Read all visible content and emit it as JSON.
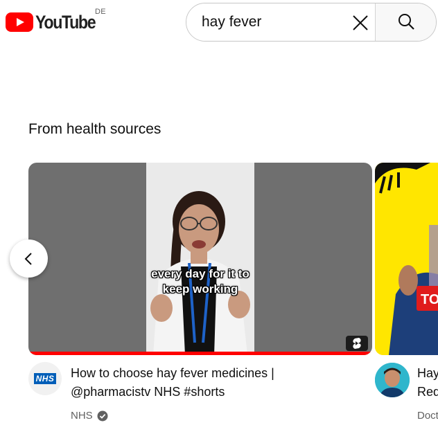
{
  "header": {
    "logo_text": "YouTube",
    "country_code": "DE",
    "search": {
      "value": "hay fever",
      "clear_icon": "close-icon",
      "search_icon": "search-icon"
    }
  },
  "section": {
    "title": "From health sources",
    "prev_icon": "chevron-left-icon"
  },
  "cards": [
    {
      "thumbnail_caption": "every day for it to keep working",
      "thumbnail_badge_icon": "shorts-icon",
      "title_line1": "How to choose hay fever medicines |",
      "title_line2": "@pharmacistv NHS #shorts",
      "channel": "NHS",
      "channel_logo": "NHS",
      "verified_icon": "verified-check-icon"
    },
    {
      "thumbnail_text": "TO",
      "title_line1": "Hay",
      "title_line2": "Red",
      "channel": "Doct"
    }
  ],
  "colors": {
    "brand_red": "#ff0000",
    "nhs_blue": "#005eb8",
    "thumb2_bg": "#ffe600"
  }
}
